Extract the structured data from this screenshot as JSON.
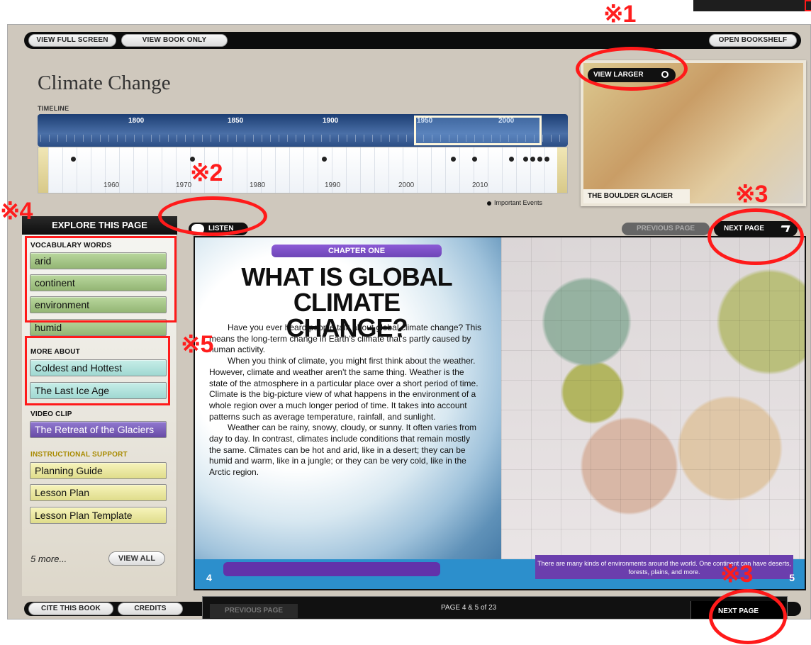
{
  "toolbar": {
    "view_full_screen": "VIEW FULL SCREEN",
    "view_book_only": "VIEW BOOK ONLY",
    "open_bookshelf": "OPEN BOOKSHELF"
  },
  "header": {
    "title": "Climate Change",
    "timeline_label": "TIMELINE"
  },
  "timeline": {
    "top_years": [
      "1800",
      "1850",
      "1900",
      "1950",
      "2000"
    ],
    "bottom_years": [
      "1960",
      "1970",
      "1980",
      "1990",
      "2000",
      "2010"
    ],
    "legend": "Important Events"
  },
  "map": {
    "view_larger": "VIEW LARGER",
    "caption": "THE BOULDER GLACIER"
  },
  "sidebar": {
    "heading": "EXPLORE THIS PAGE",
    "vocabulary_label": "VOCABULARY WORDS",
    "vocabulary": [
      "arid",
      "continent",
      "environment",
      "humid"
    ],
    "more_about_label": "MORE ABOUT",
    "more_about": [
      "Coldest and Hottest",
      "The Last Ice Age"
    ],
    "video_label": "VIDEO CLIP",
    "video": [
      "The Retreat of the Glaciers"
    ],
    "support_label": "INSTRUCTIONAL SUPPORT",
    "support": [
      "Planning Guide",
      "Lesson Plan",
      "Lesson Plan Template"
    ],
    "more_text": "5 more...",
    "view_all": "VIEW ALL"
  },
  "reader": {
    "listen": "LISTEN",
    "previous_top": "PREVIOUS PAGE",
    "next_top": "NEXT PAGE",
    "chapter": "CHAPTER ONE",
    "headline_1": "WHAT IS GLOBAL",
    "headline_2": "CLIMATE CHANGE?",
    "p1": "Have you ever heard people talk about global climate change? This means the long-term change in Earth's climate that's partly caused by human activity.",
    "p2": "When you think of climate, you might first think about the weather. However, climate and weather aren't the same thing. Weather is the state of the atmosphere in a particular place over a short period of time. Climate is the big-picture view of what happens in the environment of a whole region over a much longer period of time. It takes into account patterns such as average temperature, rainfall, and sunlight.",
    "p3": "Weather can be rainy, snowy, cloudy, or sunny. It often varies from day to day. In contrast, climates include conditions that remain mostly the same. Climates can be hot and arid, like in a desert; they can be humid and warm, like in a jungle; or they can be very cold, like in the Arctic region.",
    "left_page": "4",
    "right_page": "5",
    "caption": "There are many kinds of environments around the world. One continent can have deserts, forests, plains, and more."
  },
  "footer": {
    "cite": "CITE THIS BOOK",
    "credits": "CREDITS",
    "previous": "PREVIOUS PAGE",
    "pager": "PAGE 4 & 5 of 23",
    "next": "NEXT PAGE"
  },
  "annotations": {
    "m1": "※1",
    "m2": "※2",
    "m3": "※3",
    "m4": "※4",
    "m5": "※5"
  },
  "colors": {
    "highlight": "#ff1a1a",
    "dark": "#111111"
  }
}
